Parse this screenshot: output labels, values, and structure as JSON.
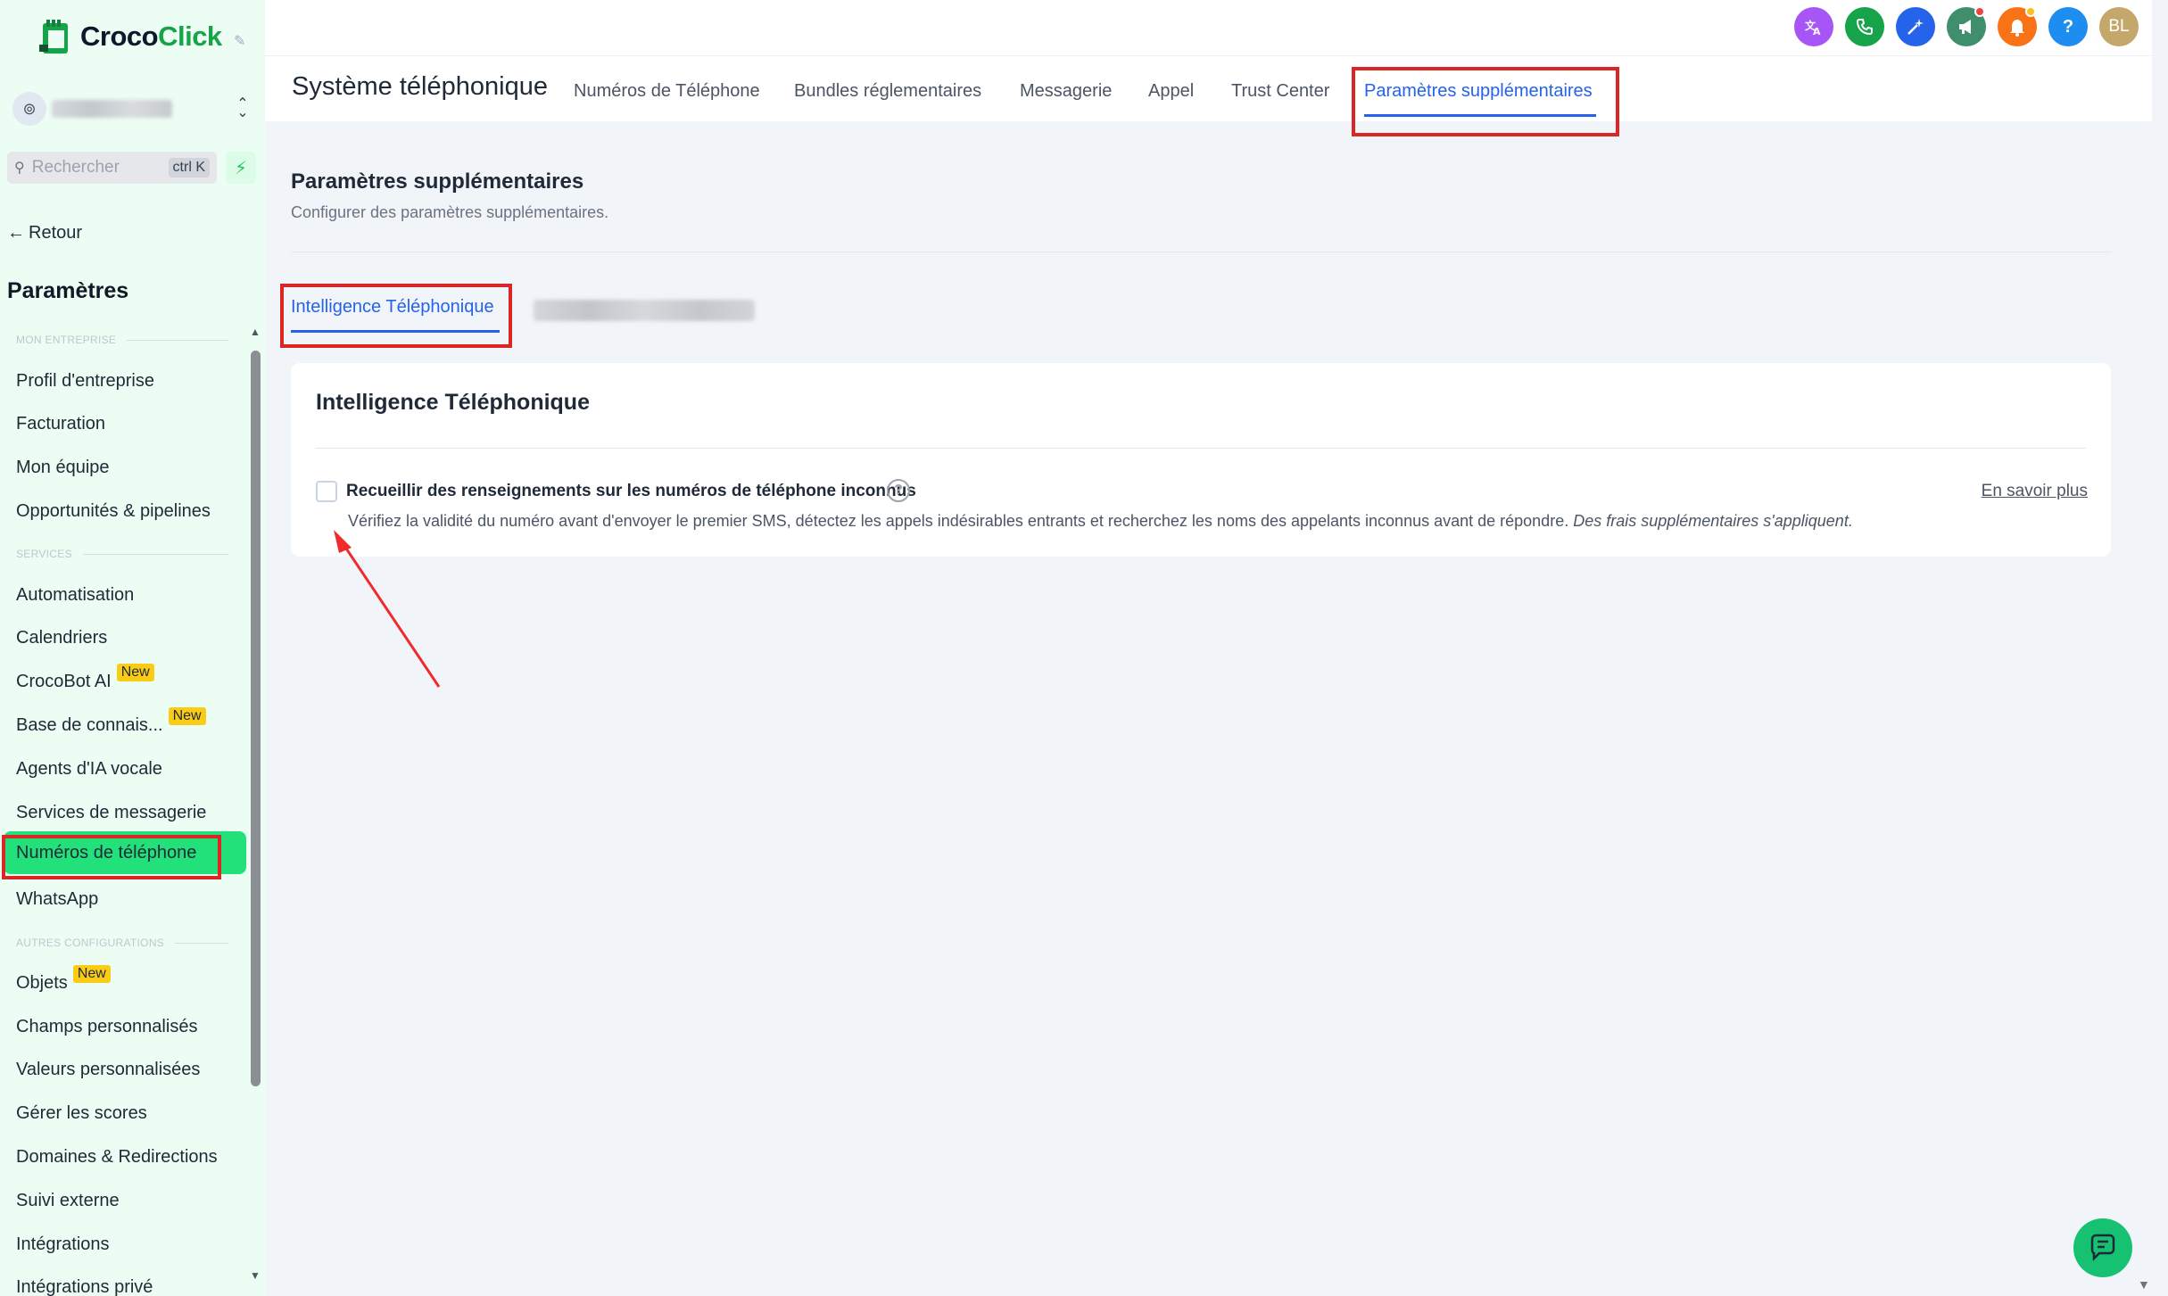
{
  "brand": {
    "name_part1": "Croco",
    "name_part2": "Click"
  },
  "sidebar": {
    "search_placeholder": "Rechercher",
    "search_shortcut": "ctrl K",
    "back_label": "Retour",
    "title": "Paramètres",
    "sections": {
      "business": "MON ENTREPRISE",
      "services": "SERVICES",
      "other": "AUTRES CONFIGURATIONS"
    },
    "items": {
      "company_profile": "Profil d'entreprise",
      "billing": "Facturation",
      "my_team": "Mon équipe",
      "opportunities": "Opportunités & pipelines",
      "automation": "Automatisation",
      "calendars": "Calendriers",
      "crocobot": "CrocoBot AI",
      "knowledge_base": "Base de connais...",
      "voice_agents": "Agents d'IA vocale",
      "messaging_services": "Services de messagerie",
      "phone_numbers": "Numéros de téléphone",
      "whatsapp": "WhatsApp",
      "objects": "Objets",
      "custom_fields": "Champs personnalisés",
      "custom_values": "Valeurs personnalisées",
      "scores": "Gérer les scores",
      "domains": "Domaines & Redirections",
      "external_tracking": "Suivi externe",
      "integrations": "Intégrations",
      "private_integrations": "Intégrations privé"
    },
    "new_badge": "New"
  },
  "topbar": {
    "avatar_initials": "BL",
    "help_glyph": "?",
    "icons": [
      "translate-icon",
      "phone-icon",
      "magic-icon",
      "megaphone-icon",
      "bell-icon",
      "help-icon"
    ],
    "colors": {
      "translate": "#a855f7",
      "phone": "#16a34a",
      "magic": "#2563eb",
      "megaphone": "#3f8f6d",
      "bell": "#f97316",
      "help": "#1d8ef0",
      "avatar": "#c4a76a"
    }
  },
  "header": {
    "title": "Système téléphonique",
    "tabs": [
      "Numéros de Téléphone",
      "Bundles réglementaires",
      "Messagerie",
      "Appel",
      "Trust Center",
      "Paramètres supplémentaires"
    ],
    "active_tab": "Paramètres supplémentaires"
  },
  "content": {
    "title": "Paramètres supplémentaires",
    "subtitle": "Configurer des paramètres supplémentaires.",
    "subtab_active": "Intelligence Téléphonique",
    "card": {
      "title": "Intelligence Téléphonique",
      "option_label": "Recueillir des renseignements sur les numéros de téléphone inconnus",
      "option_checked": false,
      "learn_more": "En savoir plus",
      "description": "Vérifiez la validité du numéro avant d'envoyer le premier SMS, détectez les appels indésirables entrants et recherchez les noms des appelants inconnus avant de répondre.",
      "description_italic": "Des frais supplémentaires s'appliquent."
    }
  },
  "accent_color": "#2563eb",
  "highlight_color": "#dc2626"
}
